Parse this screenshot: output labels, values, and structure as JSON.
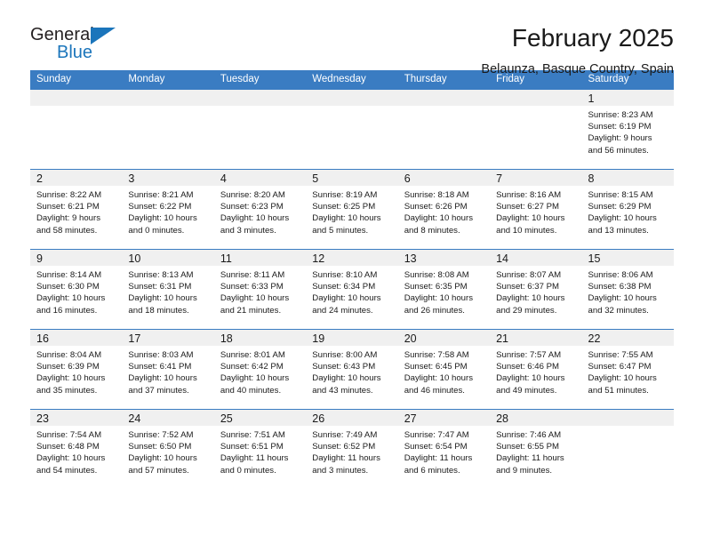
{
  "brand": {
    "name_line1": "General",
    "name_line2": "Blue",
    "accent_color": "#1b75bb"
  },
  "header": {
    "title": "February 2025",
    "subtitle": "Belaunza, Basque Country, Spain"
  },
  "calendar": {
    "header_color": "#3a7cc2",
    "weekday_headers": [
      "Sunday",
      "Monday",
      "Tuesday",
      "Wednesday",
      "Thursday",
      "Friday",
      "Saturday"
    ],
    "weeks": [
      [
        {
          "day": "",
          "empty": true
        },
        {
          "day": "",
          "empty": true
        },
        {
          "day": "",
          "empty": true
        },
        {
          "day": "",
          "empty": true
        },
        {
          "day": "",
          "empty": true
        },
        {
          "day": "",
          "empty": true
        },
        {
          "day": "1",
          "sunrise": "Sunrise: 8:23 AM",
          "sunset": "Sunset: 6:19 PM",
          "daylight_line1": "Daylight: 9 hours",
          "daylight_line2": "and 56 minutes."
        }
      ],
      [
        {
          "day": "2",
          "sunrise": "Sunrise: 8:22 AM",
          "sunset": "Sunset: 6:21 PM",
          "daylight_line1": "Daylight: 9 hours",
          "daylight_line2": "and 58 minutes."
        },
        {
          "day": "3",
          "sunrise": "Sunrise: 8:21 AM",
          "sunset": "Sunset: 6:22 PM",
          "daylight_line1": "Daylight: 10 hours",
          "daylight_line2": "and 0 minutes."
        },
        {
          "day": "4",
          "sunrise": "Sunrise: 8:20 AM",
          "sunset": "Sunset: 6:23 PM",
          "daylight_line1": "Daylight: 10 hours",
          "daylight_line2": "and 3 minutes."
        },
        {
          "day": "5",
          "sunrise": "Sunrise: 8:19 AM",
          "sunset": "Sunset: 6:25 PM",
          "daylight_line1": "Daylight: 10 hours",
          "daylight_line2": "and 5 minutes."
        },
        {
          "day": "6",
          "sunrise": "Sunrise: 8:18 AM",
          "sunset": "Sunset: 6:26 PM",
          "daylight_line1": "Daylight: 10 hours",
          "daylight_line2": "and 8 minutes."
        },
        {
          "day": "7",
          "sunrise": "Sunrise: 8:16 AM",
          "sunset": "Sunset: 6:27 PM",
          "daylight_line1": "Daylight: 10 hours",
          "daylight_line2": "and 10 minutes."
        },
        {
          "day": "8",
          "sunrise": "Sunrise: 8:15 AM",
          "sunset": "Sunset: 6:29 PM",
          "daylight_line1": "Daylight: 10 hours",
          "daylight_line2": "and 13 minutes."
        }
      ],
      [
        {
          "day": "9",
          "sunrise": "Sunrise: 8:14 AM",
          "sunset": "Sunset: 6:30 PM",
          "daylight_line1": "Daylight: 10 hours",
          "daylight_line2": "and 16 minutes."
        },
        {
          "day": "10",
          "sunrise": "Sunrise: 8:13 AM",
          "sunset": "Sunset: 6:31 PM",
          "daylight_line1": "Daylight: 10 hours",
          "daylight_line2": "and 18 minutes."
        },
        {
          "day": "11",
          "sunrise": "Sunrise: 8:11 AM",
          "sunset": "Sunset: 6:33 PM",
          "daylight_line1": "Daylight: 10 hours",
          "daylight_line2": "and 21 minutes."
        },
        {
          "day": "12",
          "sunrise": "Sunrise: 8:10 AM",
          "sunset": "Sunset: 6:34 PM",
          "daylight_line1": "Daylight: 10 hours",
          "daylight_line2": "and 24 minutes."
        },
        {
          "day": "13",
          "sunrise": "Sunrise: 8:08 AM",
          "sunset": "Sunset: 6:35 PM",
          "daylight_line1": "Daylight: 10 hours",
          "daylight_line2": "and 26 minutes."
        },
        {
          "day": "14",
          "sunrise": "Sunrise: 8:07 AM",
          "sunset": "Sunset: 6:37 PM",
          "daylight_line1": "Daylight: 10 hours",
          "daylight_line2": "and 29 minutes."
        },
        {
          "day": "15",
          "sunrise": "Sunrise: 8:06 AM",
          "sunset": "Sunset: 6:38 PM",
          "daylight_line1": "Daylight: 10 hours",
          "daylight_line2": "and 32 minutes."
        }
      ],
      [
        {
          "day": "16",
          "sunrise": "Sunrise: 8:04 AM",
          "sunset": "Sunset: 6:39 PM",
          "daylight_line1": "Daylight: 10 hours",
          "daylight_line2": "and 35 minutes."
        },
        {
          "day": "17",
          "sunrise": "Sunrise: 8:03 AM",
          "sunset": "Sunset: 6:41 PM",
          "daylight_line1": "Daylight: 10 hours",
          "daylight_line2": "and 37 minutes."
        },
        {
          "day": "18",
          "sunrise": "Sunrise: 8:01 AM",
          "sunset": "Sunset: 6:42 PM",
          "daylight_line1": "Daylight: 10 hours",
          "daylight_line2": "and 40 minutes."
        },
        {
          "day": "19",
          "sunrise": "Sunrise: 8:00 AM",
          "sunset": "Sunset: 6:43 PM",
          "daylight_line1": "Daylight: 10 hours",
          "daylight_line2": "and 43 minutes."
        },
        {
          "day": "20",
          "sunrise": "Sunrise: 7:58 AM",
          "sunset": "Sunset: 6:45 PM",
          "daylight_line1": "Daylight: 10 hours",
          "daylight_line2": "and 46 minutes."
        },
        {
          "day": "21",
          "sunrise": "Sunrise: 7:57 AM",
          "sunset": "Sunset: 6:46 PM",
          "daylight_line1": "Daylight: 10 hours",
          "daylight_line2": "and 49 minutes."
        },
        {
          "day": "22",
          "sunrise": "Sunrise: 7:55 AM",
          "sunset": "Sunset: 6:47 PM",
          "daylight_line1": "Daylight: 10 hours",
          "daylight_line2": "and 51 minutes."
        }
      ],
      [
        {
          "day": "23",
          "sunrise": "Sunrise: 7:54 AM",
          "sunset": "Sunset: 6:48 PM",
          "daylight_line1": "Daylight: 10 hours",
          "daylight_line2": "and 54 minutes."
        },
        {
          "day": "24",
          "sunrise": "Sunrise: 7:52 AM",
          "sunset": "Sunset: 6:50 PM",
          "daylight_line1": "Daylight: 10 hours",
          "daylight_line2": "and 57 minutes."
        },
        {
          "day": "25",
          "sunrise": "Sunrise: 7:51 AM",
          "sunset": "Sunset: 6:51 PM",
          "daylight_line1": "Daylight: 11 hours",
          "daylight_line2": "and 0 minutes."
        },
        {
          "day": "26",
          "sunrise": "Sunrise: 7:49 AM",
          "sunset": "Sunset: 6:52 PM",
          "daylight_line1": "Daylight: 11 hours",
          "daylight_line2": "and 3 minutes."
        },
        {
          "day": "27",
          "sunrise": "Sunrise: 7:47 AM",
          "sunset": "Sunset: 6:54 PM",
          "daylight_line1": "Daylight: 11 hours",
          "daylight_line2": "and 6 minutes."
        },
        {
          "day": "28",
          "sunrise": "Sunrise: 7:46 AM",
          "sunset": "Sunset: 6:55 PM",
          "daylight_line1": "Daylight: 11 hours",
          "daylight_line2": "and 9 minutes."
        },
        {
          "day": "",
          "empty": true
        }
      ]
    ]
  }
}
